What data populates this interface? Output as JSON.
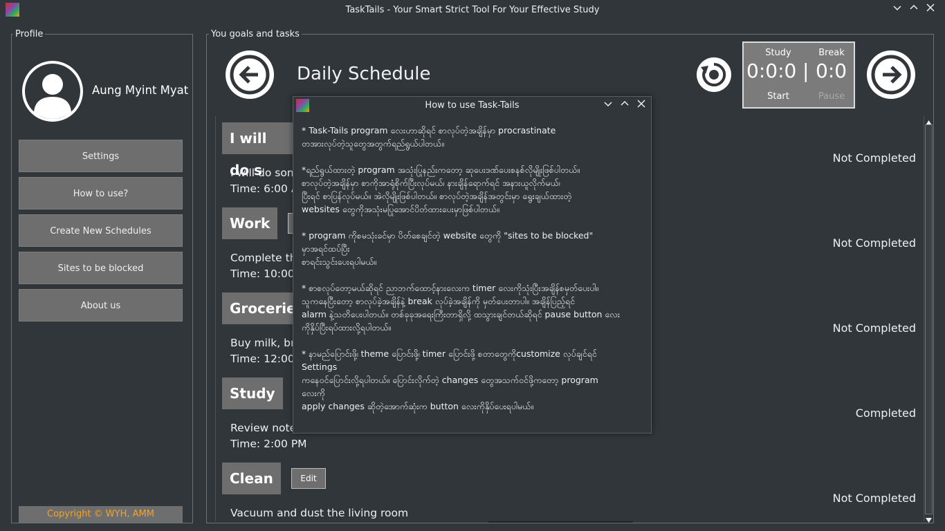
{
  "window": {
    "title": "TaskTails - Your Smart Strict Tool For Your Effective Study"
  },
  "profile": {
    "group_title": "Profile",
    "name": "Aung Myint Myat",
    "buttons": [
      "Settings",
      "How to use?",
      "Create New Schedules",
      "Sites to be blocked",
      "About us"
    ],
    "copyright": "Copyright © WYH, AMM"
  },
  "main": {
    "group_title": "You goals and tasks",
    "heading": "Daily Schedule",
    "timer": {
      "study_label": "Study",
      "break_label": "Break",
      "study_time": "0:0:0",
      "separator": "|",
      "break_time": "0:0",
      "start_label": "Start",
      "pause_label": "Pause"
    }
  },
  "schedule": [
    {
      "category": "I will do s",
      "description": "I will do som",
      "time": "Time: 6:00 A",
      "status": "Not Completed"
    },
    {
      "category": "Work",
      "description": "Complete the",
      "time": "Time: 10:00",
      "status": "Not Completed"
    },
    {
      "category": "Grocerie",
      "description": "Buy milk, bre",
      "time": "Time: 12:00",
      "status": "Not Completed"
    },
    {
      "category": "Study",
      "description": "Review note",
      "time": "Time: 2:00 PM",
      "status": "Completed"
    },
    {
      "category": "Clean",
      "description": "Vacuum and dust the living room",
      "time": "",
      "status": "Not Completed",
      "edit": "Edit"
    }
  ],
  "dialog": {
    "title": "How to use Task-Tails",
    "paragraphs": [
      "* Task-Tails program လေးဟာဆိုရင် စာလုပ်တဲ့အချိန်မှာ procrastinate\nတအားလုပ်တဲ့သူတွေအတွက်ရည်ရွယ်ပါတယ်။",
      "*ရည်ရွယ်ထားတဲ့ program အသုံးပြုနည်းကတော့ ဆုပေးဒဏ်ပေးစနစ်လိုမျိုးဖြစ်ပါတယ်။\nစာလုပ်တဲ့အချိန်မှာ စာကိုအာရုံစိုက်ပြီးလုပ်မယ်၊ နားချိန်ရောက်ရင် အနားယူလိုက်မယ်၊\nပြီးရင် စာပြန်လုပ်မယ်။ အဲလိုမျိုးဖြစ်ပါတယ်။ စာလုပ်တဲ့အချိန်အတွင်းမှာ ရွေးချယ်ထားတဲ့\nwebsites တွေကိုအသုံးမပြုအောင်ပိတ်ထားပေးမှာဖြစ်ပါတယ်။",
      "* program ကိုစမသုံးခင်မှာ ပိတ်စေချင်တဲ့ website တွေကို \"sites to be blocked\"\nမှာအရင်ထပ်ပြီး\nစာရင်းသွင်းပေးရပါမယ်။",
      "* စာစလုပ်တော့မယ်ဆိုရင် ညာဘက်ထောင့်နားလေးက timer လေးကိုသုံးပြီးအချိန်စမှတ်ပေးပါ။\nသူကနေပြီးတော့ စာလုပ်ခဲ့အချိန်နဲ့ break လုပ်ခဲ့အချိန်ကို မှတ်ပေးတာပါ။ အချိန်ပြည့်ရင်\nalarm နဲ့သတိပေးပါတယ်။ တစ်ခုခုအရေးကြီးတာရှိလို့ ထသွားချင်တယ်ဆိုရင် pause button လေး\nကိုနှိပ်ပြီးရပ်ထားလို့ရပါတယ်။",
      "* နာမည်ပြောင်းဖို့၊ theme ပြောင်းဖို့၊ timer ပြောင်းဖို့ စတာတွေကိုcustomize လုပ်ချင်ရင်\nSettings\nကနေဝင်ပြောင်းလို့ရပါတယ်။ ပြောင်းလိုက်တဲ့ changes တွေအသက်ဝင်ဖို့ကတော့ program\nလေးကို\napply changes ဆိုတဲ့အောက်ဆုံးက button လေးကိုနှိပ်ပေးရပါမယ်။"
    ]
  }
}
